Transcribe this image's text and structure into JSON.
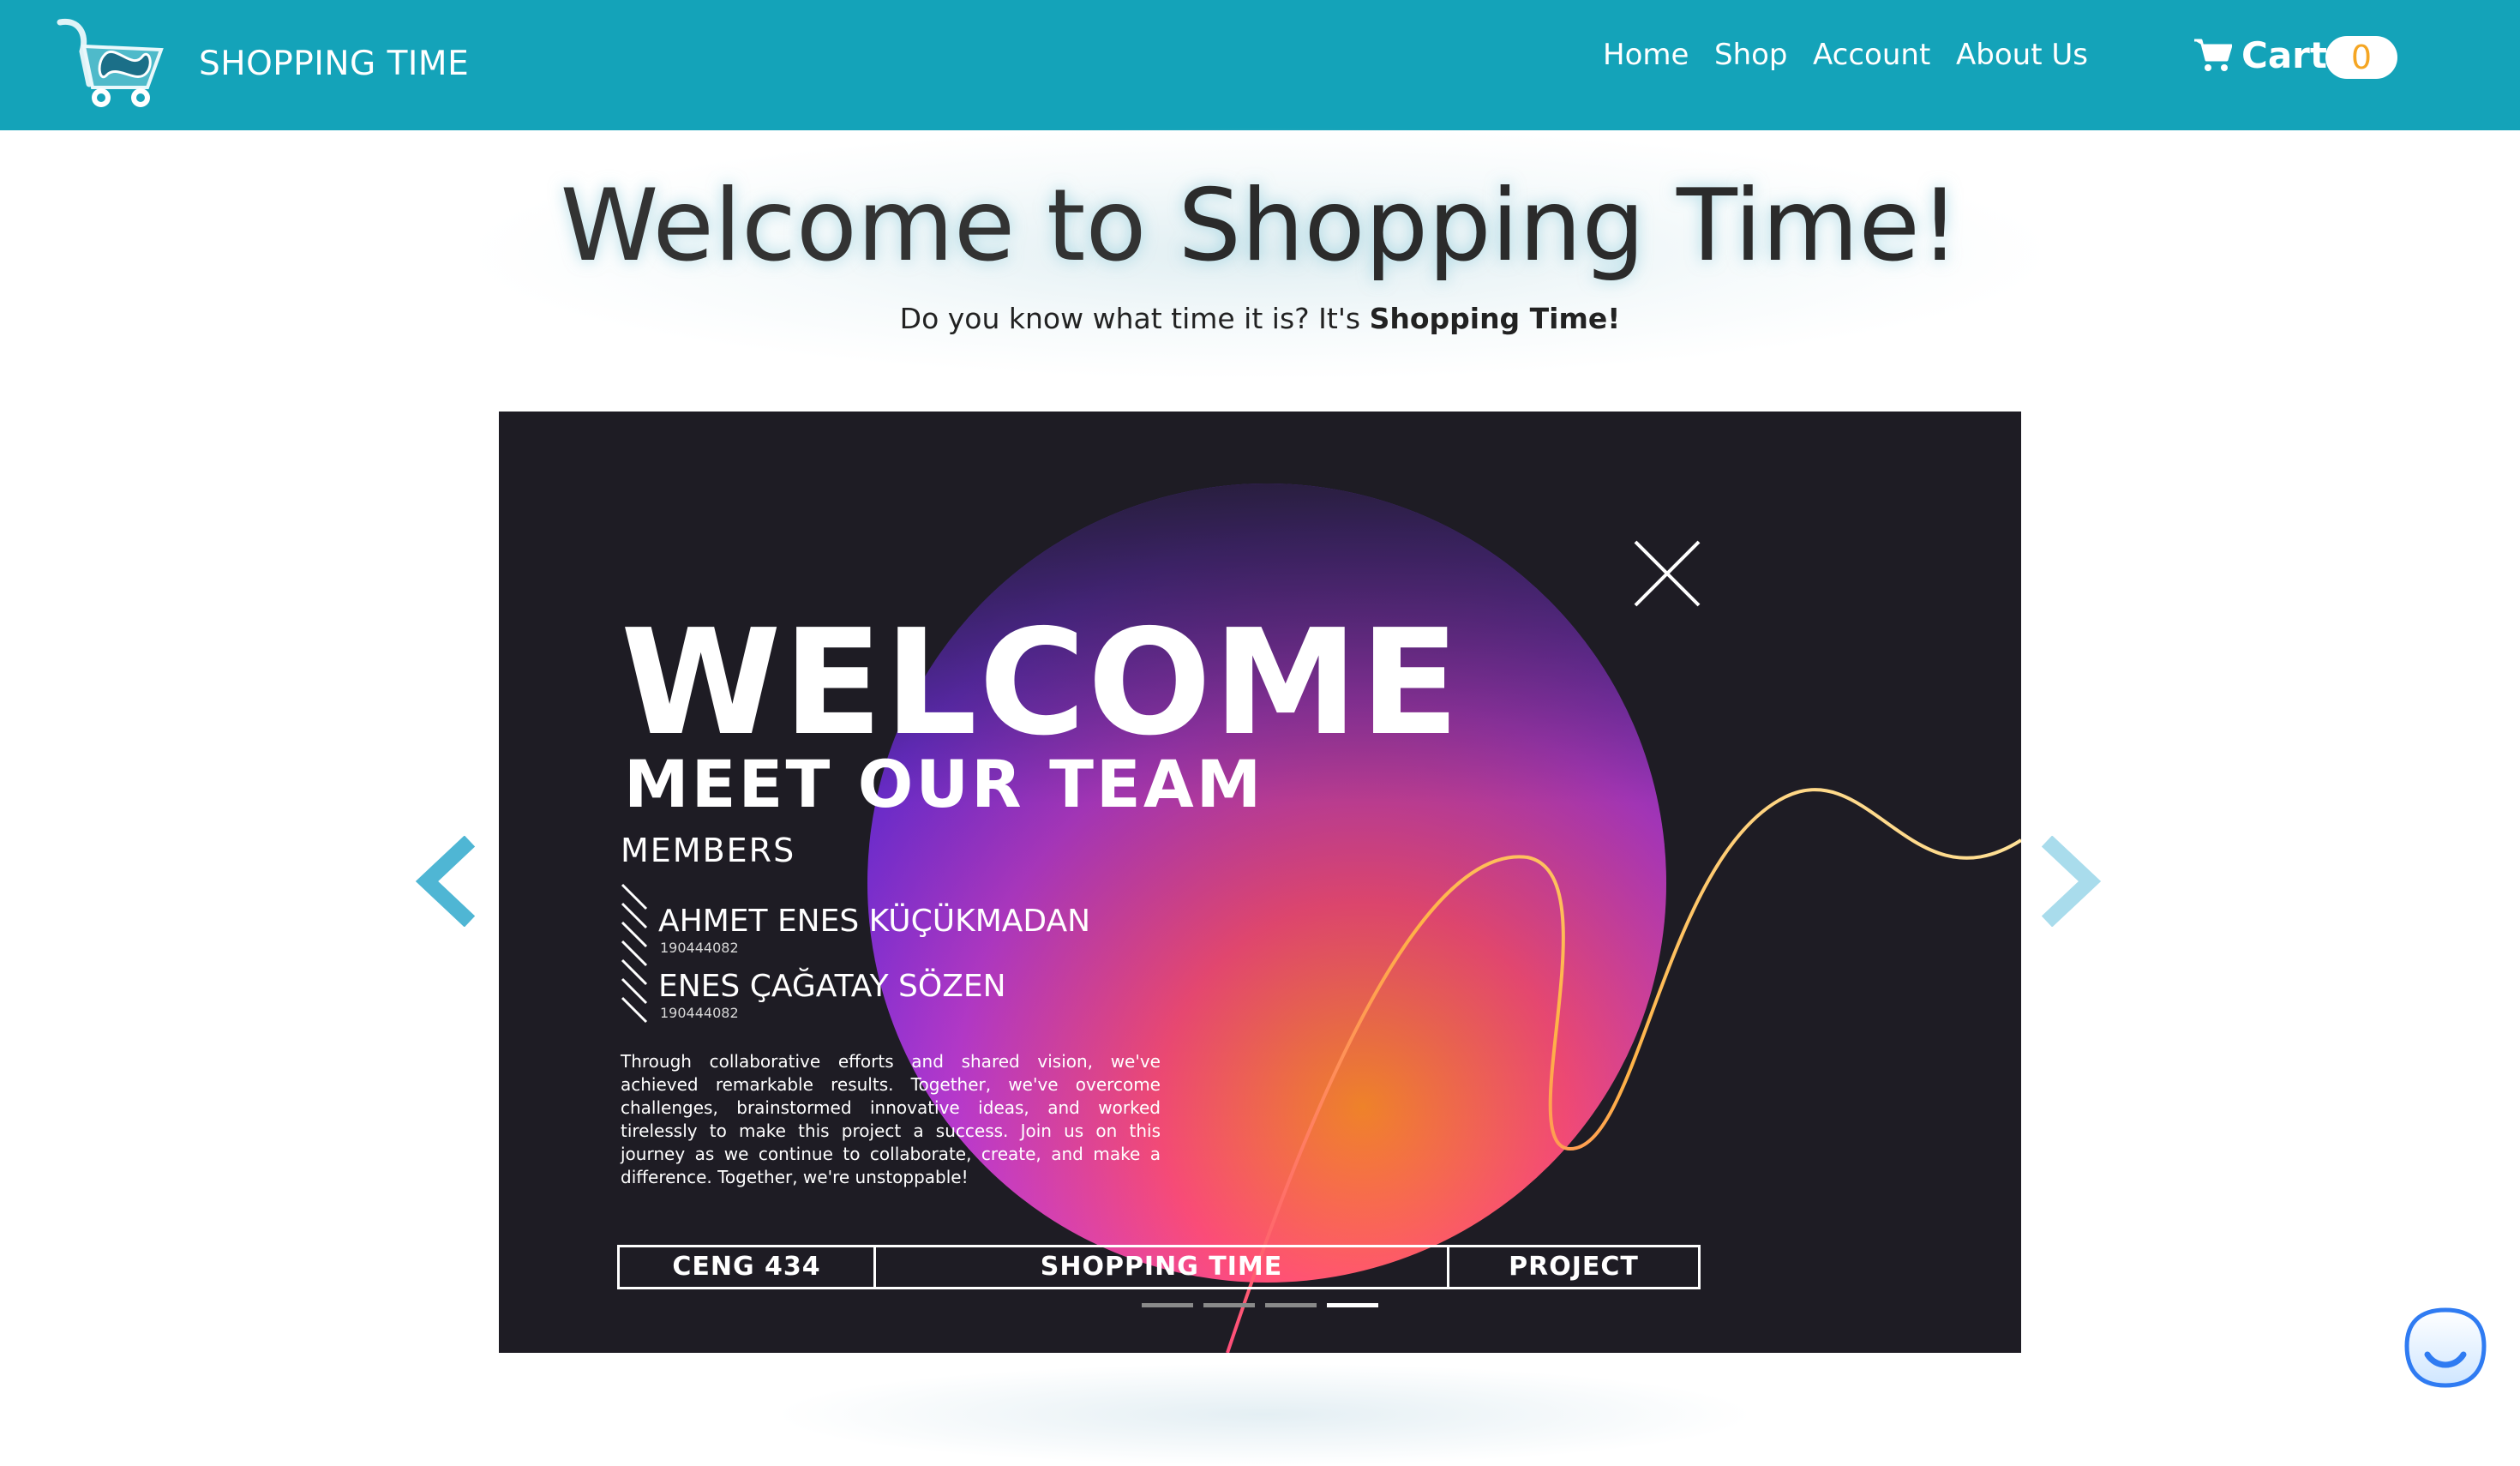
{
  "navbar": {
    "brand": "SHOPPING TIME",
    "links": [
      "Home",
      "Shop",
      "Account",
      "About Us"
    ],
    "cart_label": "Cart",
    "cart_count": "0",
    "colors": {
      "bar": "#14a3b9",
      "badge_text": "#f5a623"
    }
  },
  "hero": {
    "title_part1": "Welcome to ",
    "title_part2": "Shopping Time!",
    "subtitle_part1": "Do you know what time it is? It's ",
    "subtitle_part2": "Shopping Time!"
  },
  "carousel": {
    "heading": "WELCOME",
    "subheading": "MEET OUR TEAM",
    "members_label": "MEMBERS",
    "members": [
      {
        "name": "AHMET ENES KÜÇÜKMADAN",
        "id": "190444082"
      },
      {
        "name": "ENES ÇAĞATAY SÖZEN",
        "id": "190444082"
      }
    ],
    "description": "Through collaborative efforts and shared vision, we've achieved remarkable results. Together, we've overcome challenges, brainstormed innovative ideas, and worked tirelessly to make this project a success. Join us on this journey as we continue to collaborate, create, and make a difference. Together, we're unstoppable!",
    "footer_cells": [
      "CENG 434",
      "SHOPPING TIME",
      "PROJECT"
    ],
    "slide_count": 4,
    "active_slide": 4,
    "icons": [
      "chevron-left-icon",
      "chevron-right-icon",
      "close-x-icon"
    ]
  },
  "chat": {
    "icon": "chat-smile-icon"
  }
}
